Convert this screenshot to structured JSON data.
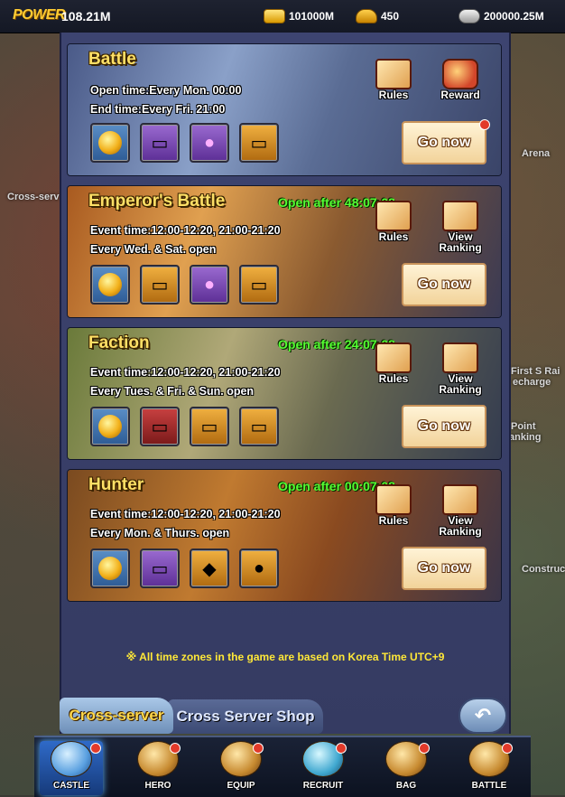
{
  "topbar": {
    "power_label": "POWER",
    "power_value": "108.21M",
    "resources": [
      {
        "icon": "gold-bar-icon",
        "value": "101000M"
      },
      {
        "icon": "gold-ingot-icon",
        "value": "450"
      },
      {
        "icon": "silver-ingot-icon",
        "value": "200000.25M"
      }
    ]
  },
  "background_labels": [
    "Cross-serv",
    "Arena",
    "First S Rai",
    "echarge",
    "Point",
    "anking",
    "Construc"
  ],
  "events": [
    {
      "title": "Battle",
      "timer": "",
      "line1": "Open time:Every Mon. 00:00",
      "line2": "End time:Every Fri. 21:00",
      "rewards": [
        "coin-icon",
        "silver-chest-icon",
        "purple-fire-orb-icon",
        "wooden-chest-icon"
      ],
      "actions": [
        {
          "label": "Rules",
          "icon": "rules-scroll-icon"
        },
        {
          "label": "Reward",
          "icon": "reward-chest-icon"
        }
      ],
      "go_label": "Go now",
      "has_badge": true
    },
    {
      "title": "Emperor's Battle",
      "timer": "Open after 48:07:08",
      "line1": "Event time:12:00-12:20, 21:00-21:20",
      "line2": "Every Wed. & Sat. open",
      "rewards": [
        "coin-icon",
        "gold-chest-icon",
        "purple-fire-orb-icon",
        "gold-treasure-chest-icon"
      ],
      "actions": [
        {
          "label": "Rules",
          "icon": "rules-scroll-icon"
        },
        {
          "label": "View Ranking",
          "icon": "ranking-scroll-icon"
        }
      ],
      "go_label": "Go now",
      "has_badge": false
    },
    {
      "title": "Faction",
      "timer": "Open after 24:07:08",
      "line1": "Event time:12:00-12:20, 21:00-21:20",
      "line2": "Every Tues. & Fri. & Sun. open",
      "rewards": [
        "coin-icon",
        "red-gem-chest-icon",
        "bronze-chest-icon",
        "gold-chest-icon"
      ],
      "actions": [
        {
          "label": "Rules",
          "icon": "rules-scroll-icon"
        },
        {
          "label": "View Ranking",
          "icon": "ranking-scroll-icon"
        }
      ],
      "go_label": "Go now",
      "has_badge": false
    },
    {
      "title": "Hunter",
      "timer": "Open after 00:07:08",
      "line1": "Event time:12:00-12:20, 21:00-21:20",
      "line2": "Every Mon. & Thurs. open",
      "rewards": [
        "coin-icon",
        "wooden-chest-icon",
        "gold-crystal-icon",
        "gold-ore-icon"
      ],
      "actions": [
        {
          "label": "Rules",
          "icon": "rules-scroll-icon"
        },
        {
          "label": "View Ranking",
          "icon": "ranking-scroll-icon"
        }
      ],
      "go_label": "Go now",
      "has_badge": false
    }
  ],
  "footer_note": "※ All time zones in the game are based on Korea Time UTC+9",
  "tabs": {
    "active": "Cross-server",
    "inactive": "Cross Server Shop"
  },
  "nav": [
    {
      "label": "CASTLE",
      "icon": "castle-icon",
      "active": true
    },
    {
      "label": "HERO",
      "icon": "hero-helmet-icon"
    },
    {
      "label": "EQUIP",
      "icon": "equip-armor-icon"
    },
    {
      "label": "RECRUIT",
      "icon": "recruit-icon"
    },
    {
      "label": "BAG",
      "icon": "bag-chest-icon"
    },
    {
      "label": "BATTLE",
      "icon": "battle-swords-icon"
    }
  ]
}
